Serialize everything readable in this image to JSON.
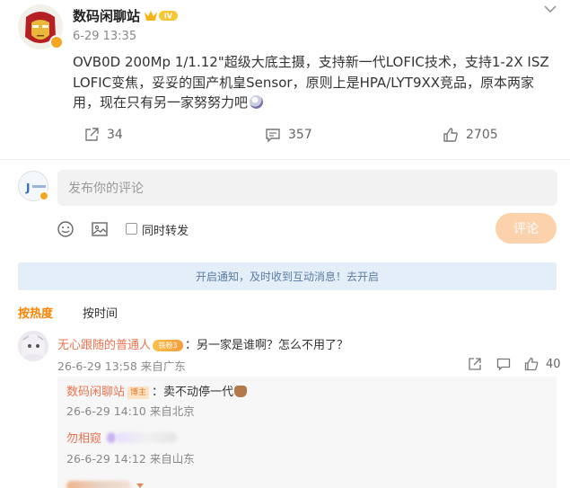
{
  "post": {
    "author": "数码闲聊站",
    "vip_badge": "IV",
    "time": "6-29 13:35",
    "text": "OVB0D 200Mp 1/1.12\"超级大底主摄，支持新一代LOFIC技术，支持1-2X ISZ LOFIC变焦，妥妥的国产机皇Sensor，原则上是HPA/LYT9XX竞品，原本两家用，现在只有另一家努努力吧",
    "repost_count": "34",
    "comment_count": "357",
    "like_count": "2705"
  },
  "composer": {
    "avatar_text": "J",
    "placeholder": "发布你的评论",
    "repost_label": "同时转发",
    "submit_label": "评论"
  },
  "notice": {
    "text": "开启通知，及时收到互动消息！去开启"
  },
  "sort_tabs": {
    "hot": "按热度",
    "time": "按时间"
  },
  "comments": [
    {
      "name": "无心跟随的普通人",
      "fan_badge": "铁粉3",
      "text": "：另一家是谁啊？怎么不用了？",
      "time": "26-6-29 13:58",
      "location": "来自广东",
      "likes": "40",
      "replies": [
        {
          "name": "数码闲聊站",
          "author_badge": "博主",
          "text": "：卖不动停一代",
          "time": "26-6-29 14:10",
          "location": "来自北京"
        },
        {
          "name": "勿相窥",
          "text": "",
          "time": "26-6-29 14:12",
          "location": "来自山东"
        }
      ]
    }
  ],
  "colors": {
    "accent": "#ff8200",
    "username": "#eb7350",
    "notice_bg": "#e4eef9",
    "submit_bg": "#fcd2ac"
  }
}
